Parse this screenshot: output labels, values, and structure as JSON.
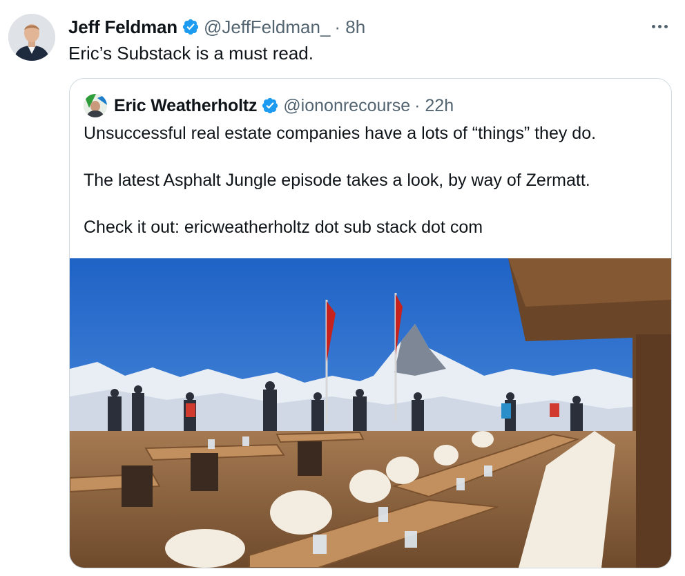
{
  "tweet": {
    "author": {
      "name": "Jeff Feldman",
      "handle": "@JeffFeldman_",
      "time": "· 8h",
      "avatar_icon": "profile-photo-man-in-suit"
    },
    "text": "Eric’s Substack is a must read.",
    "more_icon": "more-horizontal-icon",
    "verified_icon": "verified-badge-icon",
    "accent_color": "#1d9bf0"
  },
  "quote": {
    "author": {
      "name": "Eric Weatherholtz",
      "handle": "@iononrecourse",
      "time": "· 22h",
      "avatar_icon": "profile-photo-man-green-circle"
    },
    "paragraphs": [
      "Unsuccessful real estate companies have a lots of “things” they do.",
      "The latest Asphalt Jungle episode takes a look, by way of Zermatt.",
      "Check it out: ericweatherholtz dot sub stack dot com"
    ],
    "media": {
      "icon": "photo-mountain-restaurant-terrace-matterhorn"
    }
  }
}
